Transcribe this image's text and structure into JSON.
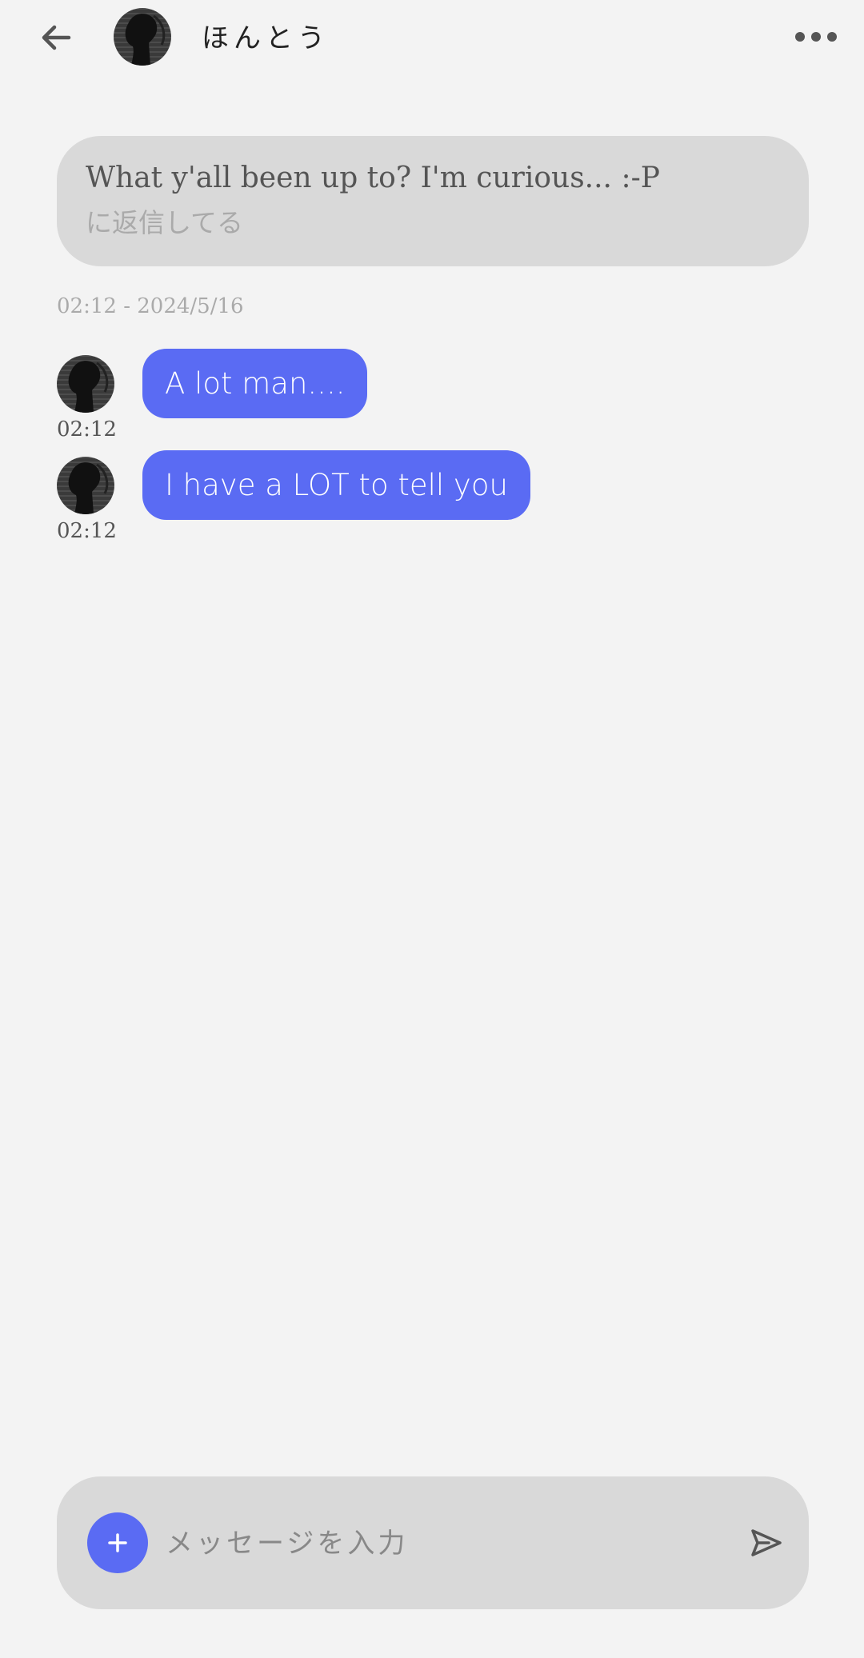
{
  "header": {
    "title": "ほんとう",
    "back_icon": "arrow-left-icon",
    "more_icon": "more-horizontal-icon"
  },
  "reply": {
    "quoted_text": "What y'all been up to? I'm curious... :-P",
    "label": "に返信してる"
  },
  "date_stamp": "02:12 - 2024/5/16",
  "messages": [
    {
      "text": "A lot man....",
      "time": "02:12"
    },
    {
      "text": "I have a LOT to tell you",
      "time": "02:12"
    }
  ],
  "composer": {
    "placeholder": "メッセージを入力",
    "add_icon": "plus-icon",
    "send_icon": "send-icon"
  },
  "colors": {
    "background": "#f3f3f3",
    "accent": "#5a6bf3",
    "bubble_gray": "#d9d9d9"
  }
}
